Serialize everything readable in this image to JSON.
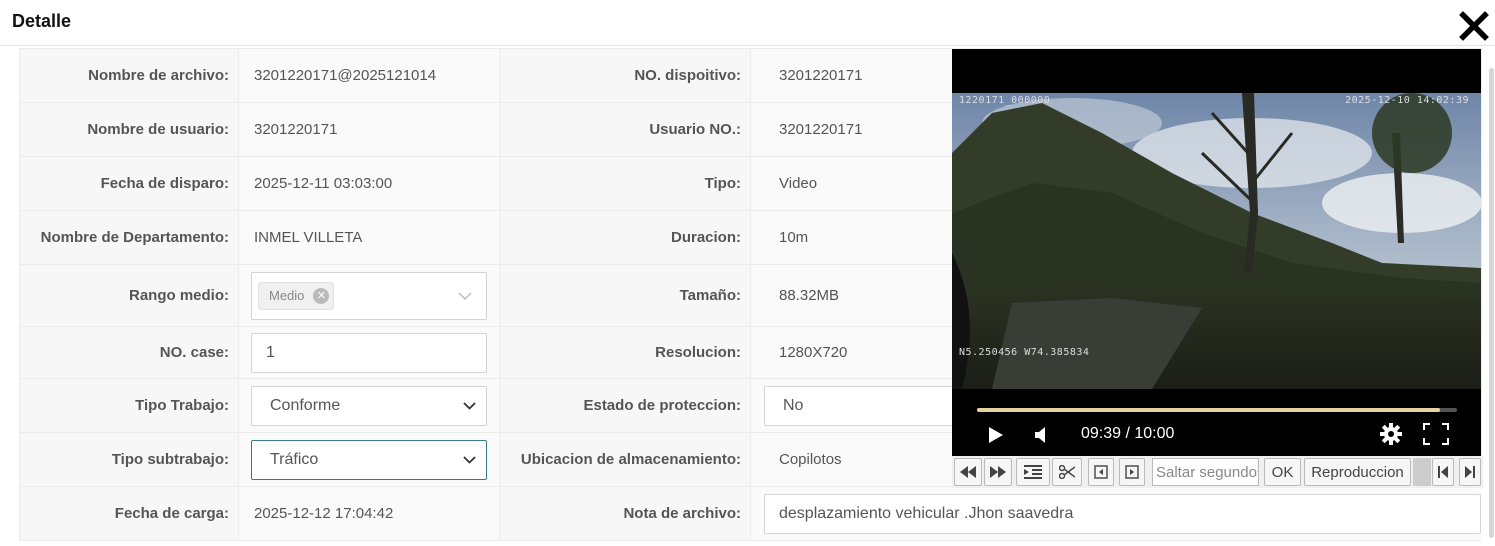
{
  "dialog": {
    "title": "Detalle"
  },
  "fields": {
    "file_name": {
      "label": "Nombre de archivo:",
      "value": "3201220171@2025121014"
    },
    "device_no": {
      "label": "NO. dispoitivo:",
      "value": "3201220171"
    },
    "user_name": {
      "label": "Nombre de usuario:",
      "value": "3201220171"
    },
    "user_no": {
      "label": "Usuario NO.:",
      "value": "3201220171"
    },
    "shot_date": {
      "label": "Fecha de disparo:",
      "value": "2025-12-11 03:03:00"
    },
    "type": {
      "label": "Tipo:",
      "value": "Video"
    },
    "department": {
      "label": "Nombre de Departamento:",
      "value": "INMEL VILLETA"
    },
    "duration": {
      "label": "Duracion:",
      "value": "10m"
    },
    "media_range": {
      "label": "Rango medio:",
      "tag": "Medio"
    },
    "size": {
      "label": "Tamaño:",
      "value": "88.32MB"
    },
    "case_no": {
      "label": "NO. case:",
      "value": "1"
    },
    "resolution": {
      "label": "Resolucion:",
      "value": "1280X720"
    },
    "work_type": {
      "label": "Tipo Trabajo:",
      "value": "Conforme"
    },
    "protection": {
      "label": "Estado de proteccion:",
      "value": "No"
    },
    "work_subtype": {
      "label": "Tipo subtrabajo:",
      "value": "Tráfico"
    },
    "storage": {
      "label": "Ubicacion de almacenamiento:",
      "value": "Copilotos"
    },
    "upload_date": {
      "label": "Fecha de carga:",
      "value": "2025-12-12 17:04:42"
    },
    "file_note": {
      "label": "Nota de archivo:",
      "value": "desplazamiento vehicular .Jhon saavedra"
    }
  },
  "player": {
    "osd_top_left": "1220171_000000",
    "osd_top_right": "2025-12-10 14:02:39",
    "osd_bottom_left": "N5.250456 W74.385834",
    "time_display": "09:39 / 10:00",
    "progress_fraction": 0.965,
    "toolbar": {
      "skip_placeholder": "Saltar segundos",
      "ok_label": "OK",
      "playback_label": "Reproduccion"
    }
  }
}
